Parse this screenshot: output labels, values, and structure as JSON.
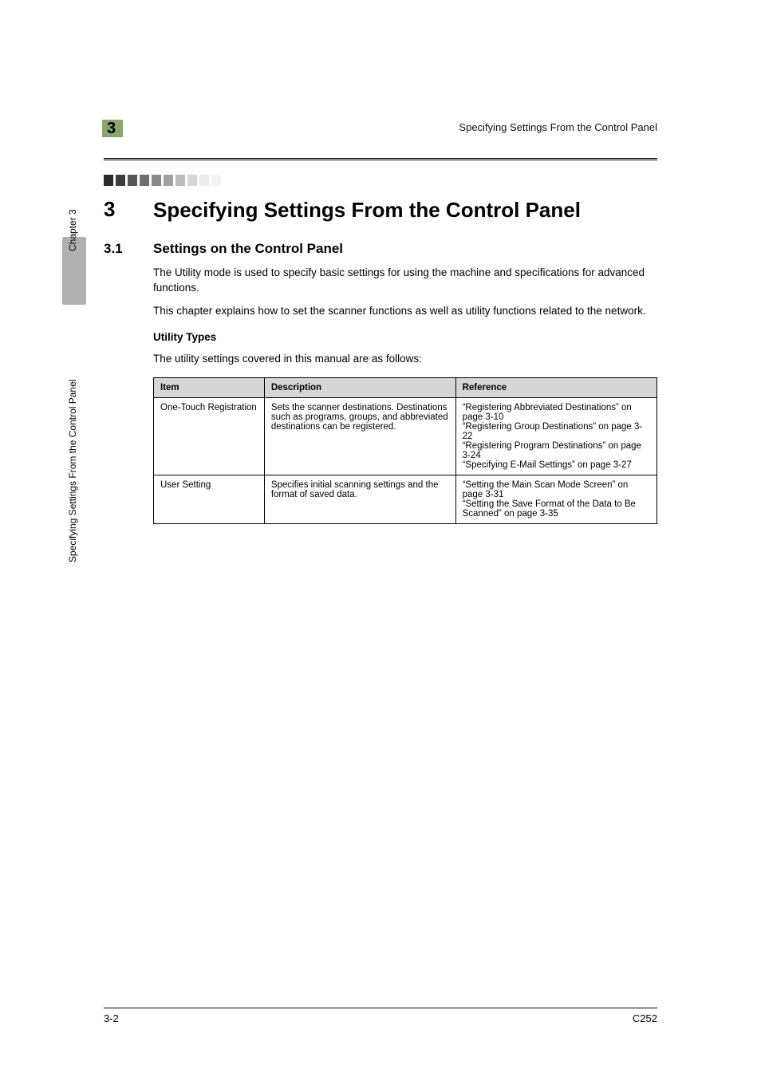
{
  "header": {
    "chapter_num": "3",
    "running_title": "Specifying Settings From the Control Panel"
  },
  "title": {
    "num": "3",
    "text": "Specifying Settings From the Control Panel"
  },
  "section": {
    "num": "3.1",
    "text": "Settings on the Control Panel"
  },
  "paras": {
    "p1": "The Utility mode is used to specify basic settings for using the machine and specifications for advanced functions.",
    "p2": "This chapter explains how to set the scanner functions as well as utility functions related to the network."
  },
  "utility": {
    "heading": "Utility Types",
    "intro": "The utility settings covered in this manual are as follows:"
  },
  "table": {
    "headers": {
      "c1": "Item",
      "c2": "Description",
      "c3": "Reference"
    },
    "rows": [
      {
        "item": "One-Touch Registration",
        "desc": "Sets the scanner destinations. Destinations such as programs, groups, and abbreviated destinations can be registered.",
        "ref": "“Registering Abbreviated Destinations” on page 3-10\n“Registering Group Destinations” on page 3-22\n“Registering Program Destinations” on page 3-24\n“Specifying E-Mail Settings” on page 3-27"
      },
      {
        "item": "User Setting",
        "desc": "Specifies initial scanning settings and the format of saved data.",
        "ref": "“Setting the Main Scan Mode Screen” on page 3-31\n“Setting the Save Format of the Data to Be Scanned” on page 3-35"
      }
    ]
  },
  "side": {
    "upper": "Chapter 3",
    "lower": "Specifying Settings From the Control Panel"
  },
  "footer": {
    "left": "3-2",
    "right": "C252"
  }
}
